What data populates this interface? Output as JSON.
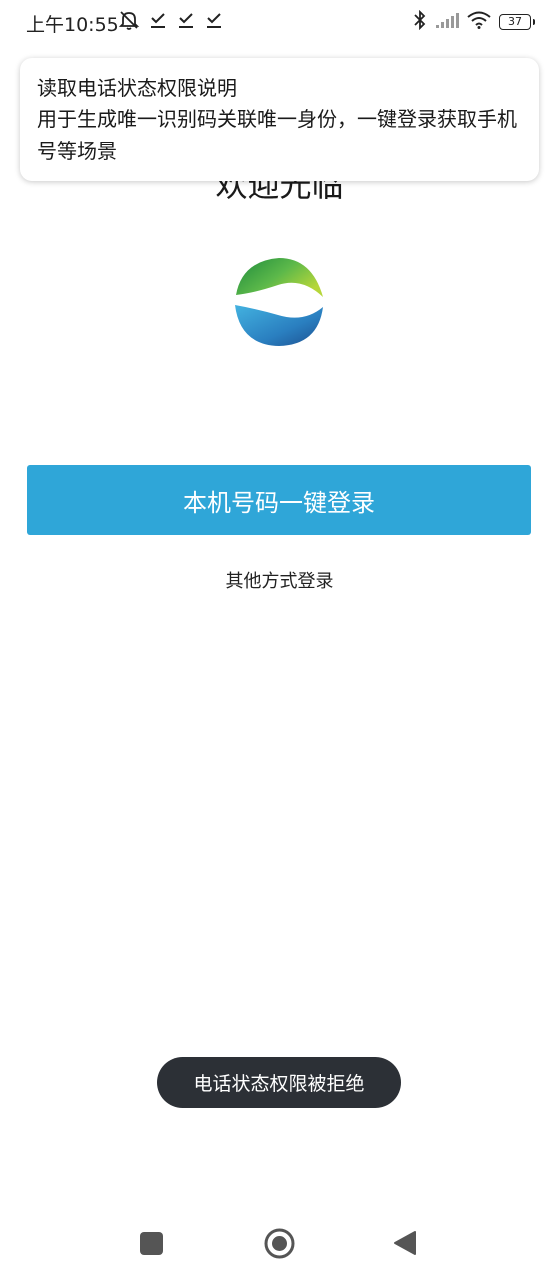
{
  "status_bar": {
    "time": "上午10:55",
    "battery": "37",
    "icons": [
      "alarm-off-icon",
      "check-icon",
      "check-icon",
      "check-icon",
      "bluetooth-icon",
      "signal-icon",
      "wifi-icon",
      "battery-icon"
    ]
  },
  "welcome": {
    "title": "欢迎光临"
  },
  "permission_dialog": {
    "title": "读取电话状态权限说明",
    "description": "用于生成唯一识别码关联唯一身份，一键登录获取手机号等场景"
  },
  "login": {
    "one_key_label": "本机号码一键登录",
    "other_label": "其他方式登录"
  },
  "toast": {
    "message": "电话状态权限被拒绝"
  },
  "colors": {
    "accent": "#2fa6d8",
    "toast_bg": "#2c3036"
  }
}
